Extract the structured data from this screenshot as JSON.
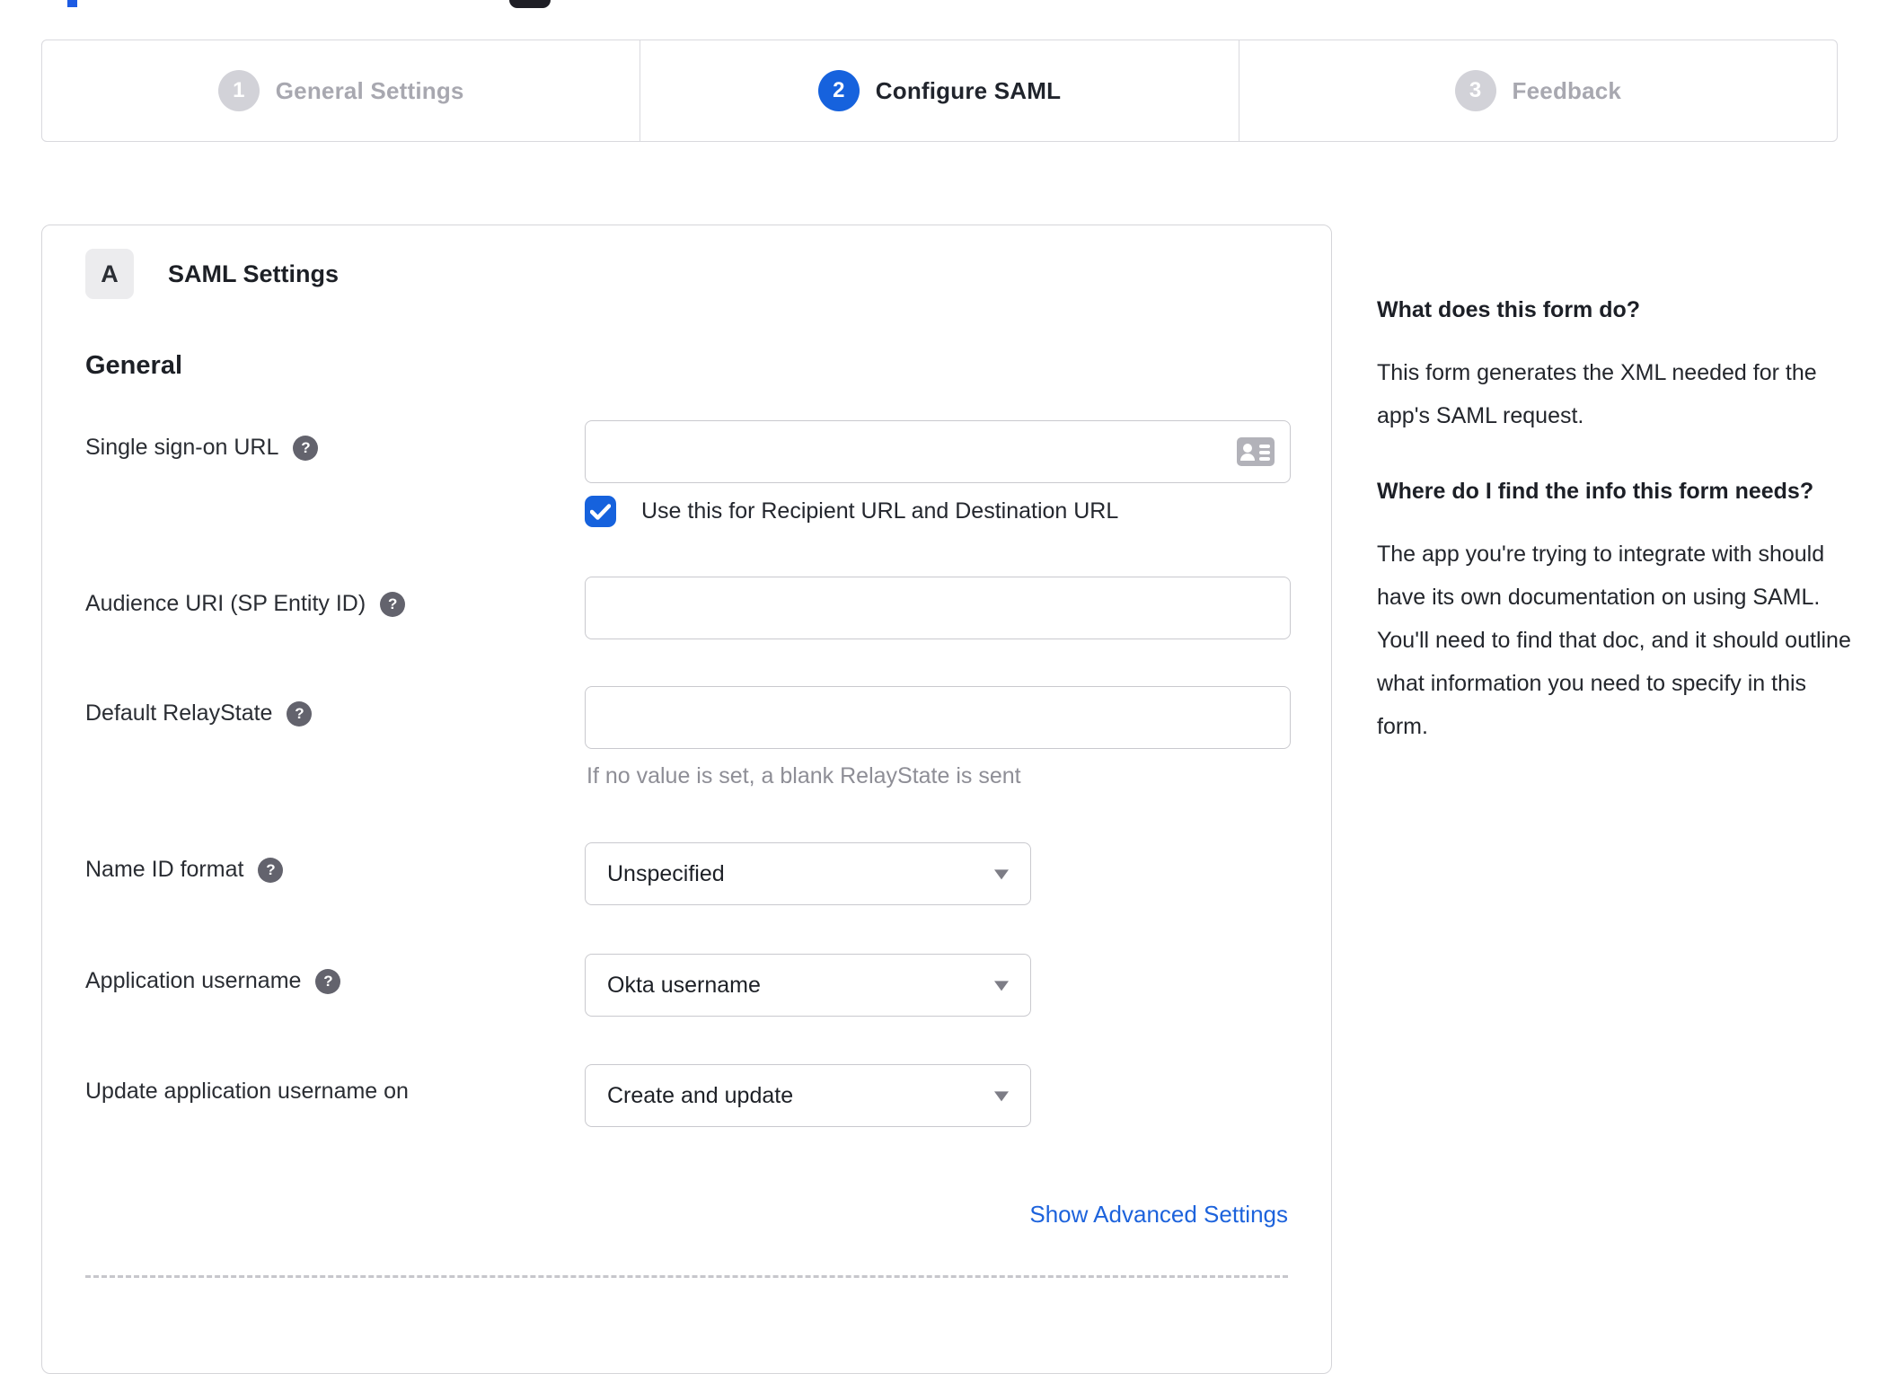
{
  "stepper": {
    "steps": [
      {
        "number": "1",
        "label": "General Settings",
        "state": "inactive"
      },
      {
        "number": "2",
        "label": "Configure SAML",
        "state": "active"
      },
      {
        "number": "3",
        "label": "Feedback",
        "state": "inactive"
      }
    ]
  },
  "panel": {
    "badge": "A",
    "title": "SAML Settings",
    "section_title": "General",
    "fields": [
      {
        "label": "Single sign-on URL",
        "type": "text",
        "value": "",
        "has_help": true
      },
      {
        "label": "Audience URI (SP Entity ID)",
        "type": "text",
        "value": "",
        "has_help": true
      },
      {
        "label": "Default RelayState",
        "type": "text",
        "value": "",
        "has_help": true,
        "hint": "If no value is set, a blank RelayState is sent"
      },
      {
        "label": "Name ID format",
        "type": "select",
        "value": "Unspecified",
        "has_help": true
      },
      {
        "label": "Application username",
        "type": "select",
        "value": "Okta username",
        "has_help": true
      },
      {
        "label": "Update application username on",
        "type": "select",
        "value": "Create and update",
        "has_help": false
      }
    ],
    "checkbox": {
      "label": "Use this for Recipient URL and Destination URL",
      "checked": true
    },
    "advanced_link": "Show Advanced Settings"
  },
  "sidebar": {
    "sections": [
      {
        "heading": "What does this form do?",
        "body": "This form generates the XML needed for the app's SAML request."
      },
      {
        "heading": "Where do I find the info this form needs?",
        "body": "The app you're trying to integrate with should have its own documentation on using SAML. You'll need to find that doc, and it should outline what information you need to specify in this form."
      }
    ]
  },
  "icons": {
    "help_glyph": "?",
    "contact_card": "contact-card-icon",
    "caret": "chevron-down",
    "check": "checkmark"
  },
  "colors": {
    "accent_blue": "#1662dd",
    "link_blue": "#1d63dc",
    "inactive_gray": "#a8a8b0",
    "border_gray": "#c9c9ce",
    "hint_gray": "#8e8e96"
  }
}
